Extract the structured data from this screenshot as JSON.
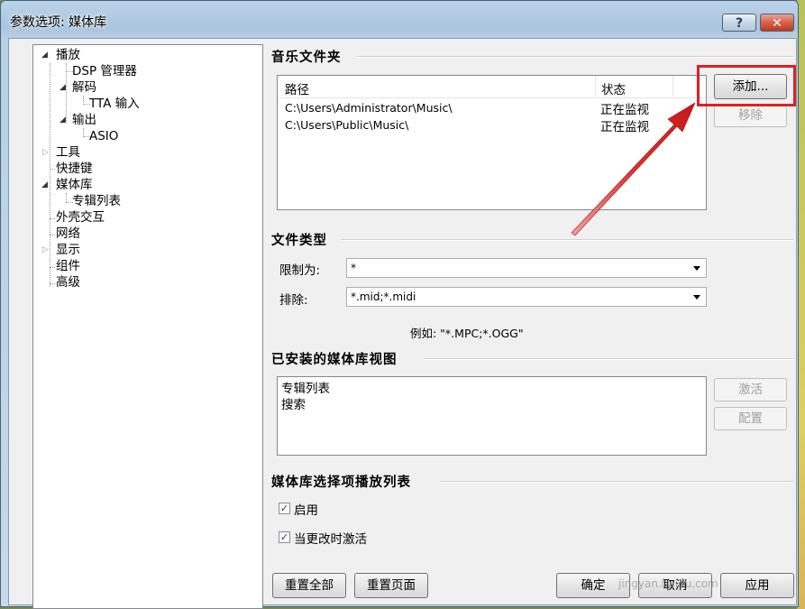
{
  "window": {
    "title": "参数选项: 媒体库",
    "help": "?",
    "close": "✕"
  },
  "tree": {
    "items": [
      {
        "label": "播放",
        "level": 0,
        "expander": "open"
      },
      {
        "label": "DSP 管理器",
        "level": 1,
        "expander": "none"
      },
      {
        "label": "解码",
        "level": 1,
        "expander": "open"
      },
      {
        "label": "TTA 输入",
        "level": 2,
        "expander": "none"
      },
      {
        "label": "输出",
        "level": 1,
        "expander": "open"
      },
      {
        "label": "ASIO",
        "level": 2,
        "expander": "none"
      },
      {
        "label": "工具",
        "level": 0,
        "expander": "closed"
      },
      {
        "label": "快捷键",
        "level": 0,
        "expander": "none"
      },
      {
        "label": "媒体库",
        "level": 0,
        "expander": "open"
      },
      {
        "label": "专辑列表",
        "level": 1,
        "expander": "none"
      },
      {
        "label": "外壳交互",
        "level": 0,
        "expander": "none"
      },
      {
        "label": "网络",
        "level": 0,
        "expander": "none"
      },
      {
        "label": "显示",
        "level": 0,
        "expander": "closed"
      },
      {
        "label": "组件",
        "level": 0,
        "expander": "none"
      },
      {
        "label": "高级",
        "level": 0,
        "expander": "none"
      }
    ]
  },
  "music_folders": {
    "title": "音乐文件夹",
    "columns": [
      "路径",
      "状态"
    ],
    "rows": [
      {
        "path": "C:\\Users\\Administrator\\Music\\",
        "status": "正在监视"
      },
      {
        "path": "C:\\Users\\Public\\Music\\",
        "status": "正在监视"
      }
    ],
    "add_label": "添加...",
    "remove_label": "移除"
  },
  "file_types": {
    "title": "文件类型",
    "restrict_label": "限制为:",
    "restrict_value": "*",
    "exclude_label": "排除:",
    "exclude_value": "*.mid;*.midi",
    "example": "例如: \"*.MPC;*.OGG\""
  },
  "installed_views": {
    "title": "已安装的媒体库视图",
    "items": [
      "专辑列表",
      "搜索"
    ],
    "activate_label": "激活",
    "configure_label": "配置"
  },
  "playlist": {
    "title": "媒体库选择项播放列表",
    "enable_label": "启用",
    "enable_checked": true,
    "activate_on_change_label": "当更改时激活",
    "activate_on_change_checked": true
  },
  "footer": {
    "reset_all": "重置全部",
    "reset_page": "重置页面",
    "ok": "确定",
    "cancel": "取消",
    "apply": "应用"
  },
  "watermark": "jingyan.baidu.com",
  "colors": {
    "annotation": "#e02020"
  }
}
